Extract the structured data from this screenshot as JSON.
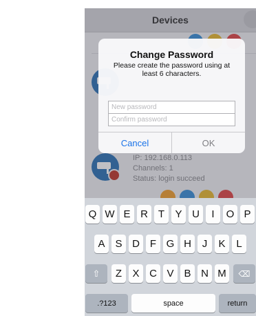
{
  "nav": {
    "title": "Devices"
  },
  "devices": [
    {
      "ip": "IP: 192.168.0.113",
      "channels": "Channels: 1",
      "status": "Status: login succeed"
    }
  ],
  "dialog": {
    "title": "Change Password",
    "message": "Please create the password using at least 6 characters.",
    "new_password_placeholder": "New password",
    "confirm_password_placeholder": "Confirm password",
    "cancel_label": "Cancel",
    "ok_label": "OK"
  },
  "keyboard": {
    "row1": [
      "Q",
      "W",
      "E",
      "R",
      "T",
      "Y",
      "U",
      "I",
      "O",
      "P"
    ],
    "row2": [
      "A",
      "S",
      "D",
      "F",
      "G",
      "H",
      "J",
      "K",
      "L"
    ],
    "row3": [
      "Z",
      "X",
      "C",
      "V",
      "B",
      "N",
      "M"
    ],
    "mode_label": ".?123",
    "space_label": "space",
    "return_label": "return"
  },
  "colors": {
    "accent": "#1a73e8",
    "device_icon": "#2e73b5",
    "lock_badge": "#c0392b",
    "action_orange": "#f0a030",
    "action_blue": "#3a8fd8",
    "action_yellow": "#e8b830",
    "action_red": "#e04848"
  },
  "icons": {
    "device": "camera-icon",
    "badge": "lock-icon",
    "shift": "shift-icon",
    "delete": "delete-icon"
  }
}
